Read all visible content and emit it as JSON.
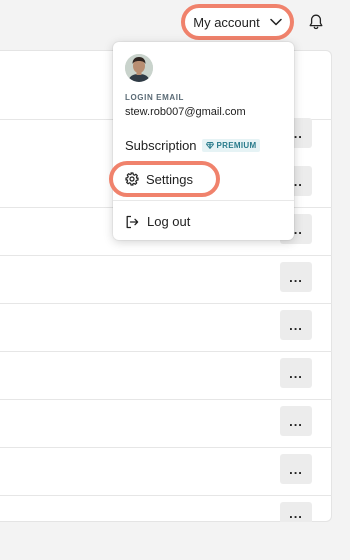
{
  "header": {
    "account_label": "My account"
  },
  "dropdown": {
    "login_label": "LOGIN EMAIL",
    "email": "stew.rob007@gmail.com",
    "subscription_label": "Subscription",
    "premium_badge": "PREMIUM",
    "settings_label": "Settings",
    "logout_label": "Log out"
  },
  "list": {
    "more_label": "..."
  },
  "colors": {
    "highlight": "#f0826c",
    "badge_bg": "#e6f3f5",
    "badge_text": "#2a7c8c"
  }
}
